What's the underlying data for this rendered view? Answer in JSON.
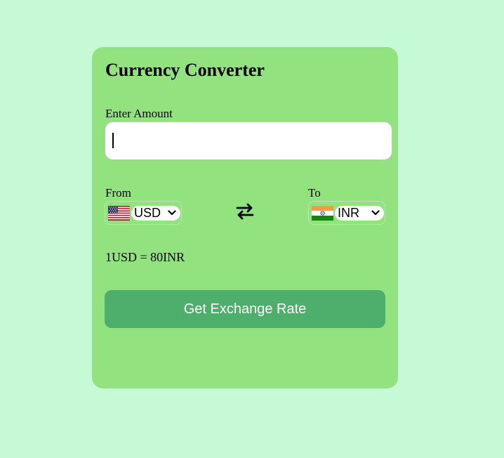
{
  "converter": {
    "title": "Currency Converter",
    "amount_label": "Enter Amount",
    "amount_value": "",
    "from": {
      "label": "From",
      "currency": "USD",
      "flag": "us-flag-icon"
    },
    "to": {
      "label": "To",
      "currency": "INR",
      "flag": "india-flag-icon"
    },
    "swap_icon": "swap-arrows-icon",
    "rate_message": "1USD = 80INR",
    "button_label": "Get Exchange Rate"
  },
  "colors": {
    "page_background": "#c6f9d5",
    "card_background": "#92e280",
    "button_background": "#4daf6b",
    "button_text": "#ffffff"
  }
}
